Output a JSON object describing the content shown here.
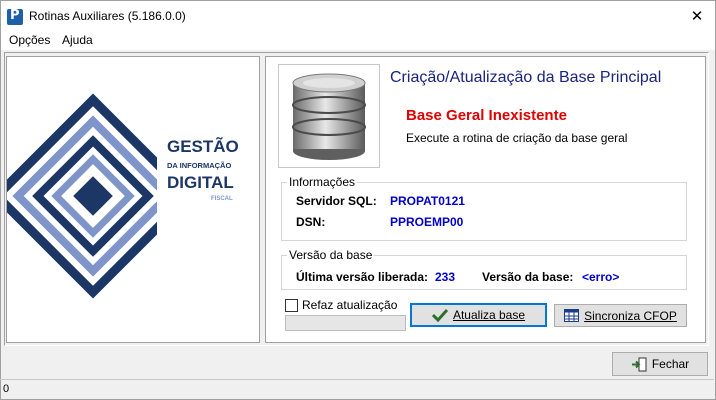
{
  "window": {
    "title": "Rotinas Auxiliares (5.186.0.0)",
    "app_icon_glyph": "P",
    "close_glyph": "✕"
  },
  "menu": {
    "items": [
      "Opções",
      "Ajuda"
    ]
  },
  "logo": {
    "line1": "GESTÃO",
    "line2": "DA INFORMAÇÃO",
    "line3": "DIGITAL",
    "line4": "FISCAL",
    "color_dark": "#1c3766",
    "color_light": "#7f95c9"
  },
  "header": {
    "title": "Criação/Atualização da Base Principal",
    "status": "Base Geral Inexistente",
    "description": "Execute a rotina de criação da base geral",
    "icon": "database-icon"
  },
  "info": {
    "label": "Informações",
    "server_label": "Servidor SQL:",
    "server_value": "PROPAT0121",
    "dsn_label": "DSN:",
    "dsn_value": "PPROEMP00"
  },
  "version": {
    "label": "Versão da base",
    "latest_label": "Última versão liberada:",
    "latest_value": "233",
    "base_label": "Versão da base:",
    "base_value": "<erro>"
  },
  "actions": {
    "refaz_label": "Refaz atualização",
    "refaz_checked": false,
    "progress": 0,
    "atualiza_label": "Atualiza base",
    "sincroniza_label": "Sincroniza CFOP"
  },
  "footer": {
    "fechar_label": "Fechar",
    "status_value": "0"
  },
  "colors": {
    "title_blue": "#1a237e",
    "status_red": "#e00000",
    "value_blue": "#0000c8"
  }
}
